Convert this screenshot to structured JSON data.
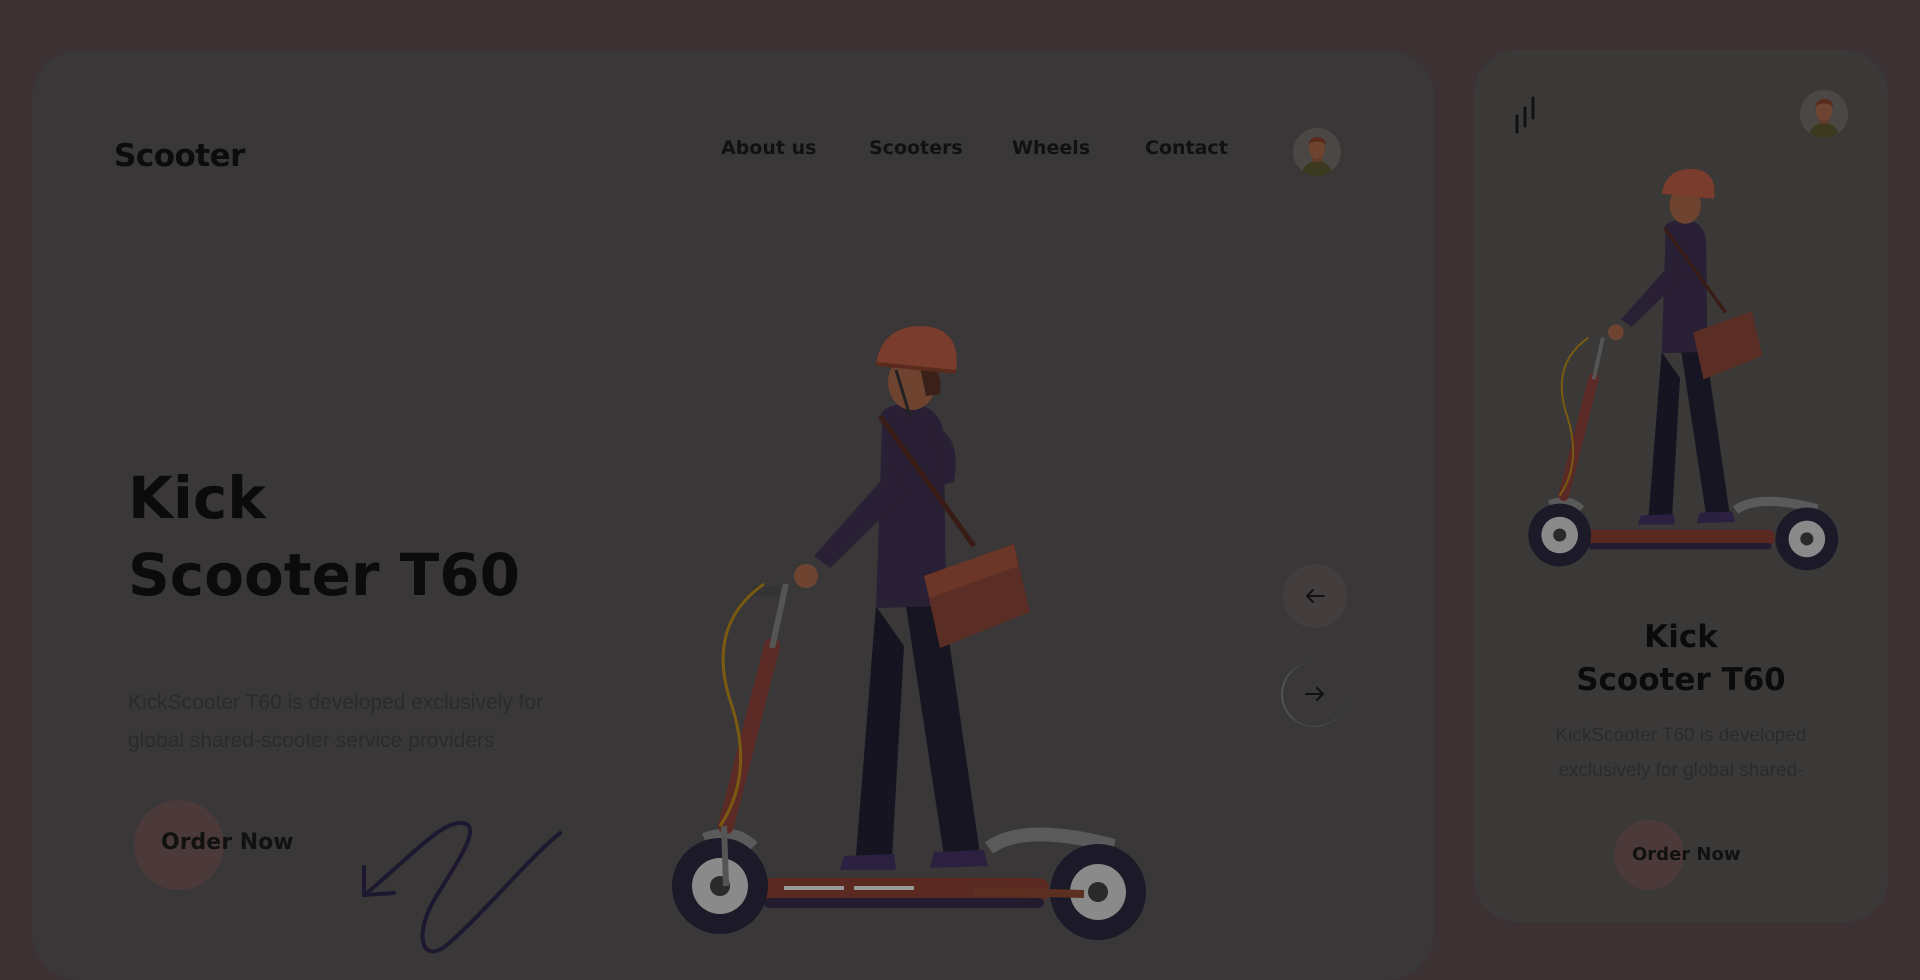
{
  "brand": {
    "name": "Scooter"
  },
  "nav": {
    "items": [
      {
        "label": "About us"
      },
      {
        "label": "Scooters"
      },
      {
        "label": "Wheels"
      },
      {
        "label": "Contact"
      }
    ],
    "avatar_icon": "user-avatar-icon"
  },
  "hero": {
    "title_line1": "Kick",
    "title_line2": "Scooter T60",
    "description": "KickScooter T60 is developed exclusively for global shared-scooter service providers",
    "order_label": "Order Now"
  },
  "carousel": {
    "prev_icon": "arrow-left-icon",
    "next_icon": "arrow-right-icon"
  },
  "mobile": {
    "menu_icon": "menu-bars-icon",
    "title_line1": "Kick",
    "title_line2": "Scooter T60",
    "description": "KickScooter T60 is developed exclusively for global shared-",
    "order_label": "Order Now"
  },
  "colors": {
    "background": "#3c3232",
    "card": "#393737",
    "accent_button": "#4c3a3a",
    "text_dark": "#0b0b0b",
    "helmet": "#7a3c2c",
    "jacket": "#2a2035",
    "bag": "#5a2e24",
    "scooter_stem": "#5c2a25"
  }
}
